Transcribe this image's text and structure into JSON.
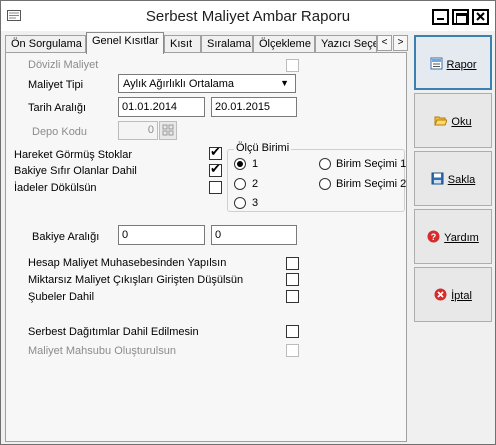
{
  "window": {
    "title": "Serbest Maliyet Ambar Raporu"
  },
  "tabs": [
    {
      "label": "Ön Sorgulama"
    },
    {
      "label": "Genel Kısıtlar"
    },
    {
      "label": "Kısıt"
    },
    {
      "label": "Sıralama"
    },
    {
      "label": "Ölçekleme"
    },
    {
      "label": "Yazıcı Seçe"
    }
  ],
  "scroll": {
    "left": "<",
    "right": ">"
  },
  "form": {
    "dovizli_maliyet": {
      "label": "Dövizli Maliyet",
      "checked": false
    },
    "maliyet_tipi": {
      "label": "Maliyet Tipi",
      "value": "Aylık Ağırlıklı Ortalama"
    },
    "tarih_araligi": {
      "label": "Tarih Aralığı",
      "from": "01.01.2014",
      "to": "20.01.2015"
    },
    "depo_kodu": {
      "label": "Depo Kodu",
      "value": "0"
    },
    "hareket_gormus": {
      "label": "Hareket Görmüş Stoklar",
      "checked": true
    },
    "bakiye_sifir": {
      "label": "Bakiye Sıfır Olanlar Dahil",
      "checked": true
    },
    "iadeler": {
      "label": "İadeler Dökülsün",
      "checked": false
    },
    "olcu_birimi": {
      "title": "Ölçü Birimi",
      "options": [
        "1",
        "2",
        "3",
        "Birim Seçimi 1",
        "Birim Seçimi 2"
      ],
      "selected": "1"
    },
    "bakiye_araligi": {
      "label": "Bakiye Aralığı",
      "from": "0",
      "to": "0"
    },
    "hesap_maliyet": {
      "label": "Hesap Maliyet Muhasebesinden Yapılsın",
      "checked": false
    },
    "miktarsiz": {
      "label": "Miktarsız Maliyet Çıkışları Girişten Düşülsün",
      "checked": false
    },
    "subeler": {
      "label": "Şubeler Dahil",
      "checked": false
    },
    "serbest_dagitim": {
      "label": "Serbest Dağıtımlar Dahil Edilmesin",
      "checked": false
    },
    "maliyet_mahsubu": {
      "label": "Maliyet Mahsubu Oluşturulsun",
      "checked": false
    }
  },
  "sidebar": {
    "rapor": {
      "label": "Rapor",
      "icon": "report-icon"
    },
    "oku": {
      "label": "Oku",
      "icon": "folder-open-icon"
    },
    "sakla": {
      "label": "Sakla",
      "icon": "save-icon"
    },
    "yardim": {
      "label": "Yardım",
      "icon": "help-icon"
    },
    "iptal": {
      "label": "İptal",
      "icon": "cancel-icon"
    }
  }
}
